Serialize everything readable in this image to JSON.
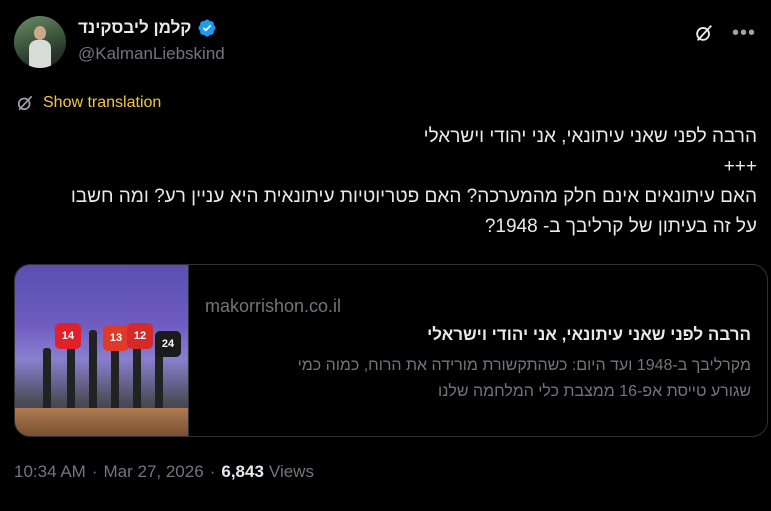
{
  "author": {
    "display_name": "קלמן ליבסקינד",
    "handle": "@KalmanLiebskind"
  },
  "translate_label": "Show translation",
  "tweet_lines": [
    "הרבה לפני שאני עיתונאי, אני יהודי וישראלי",
    "+++",
    "האם עיתונאים אינם חלק מהמערכה? האם פטריוטיות עיתונאית היא עניין רע? ומה חשבו",
    "על זה בעיתון של קרליבך ב- 1948?"
  ],
  "card": {
    "domain": "makorrishon.co.il",
    "title": "הרבה לפני שאני עיתונאי, אני יהודי וישראלי",
    "description_lines": [
      "מקרליבך ב-1948 ועד היום: כשהתקשורת מורידה את הרוח, כמוה כמי",
      "שגורע טייסת אפ-16 ממצבת כלי המלחמה שלנו"
    ],
    "thumb_labels": [
      "14",
      "13",
      "12",
      "24"
    ]
  },
  "meta": {
    "time": "10:34 AM",
    "date": "Mar 27, 2026",
    "views_count": "6,843",
    "views_label": "Views",
    "dot": "·"
  },
  "icons": {
    "verified": "verified-badge-icon",
    "grok": "grok-icon",
    "more": "more-icon",
    "translate": "translate-icon"
  },
  "colors": {
    "background": "#000000",
    "verified": "#1d9bf0",
    "translate": "#f2c83d",
    "muted": "#71767b"
  }
}
